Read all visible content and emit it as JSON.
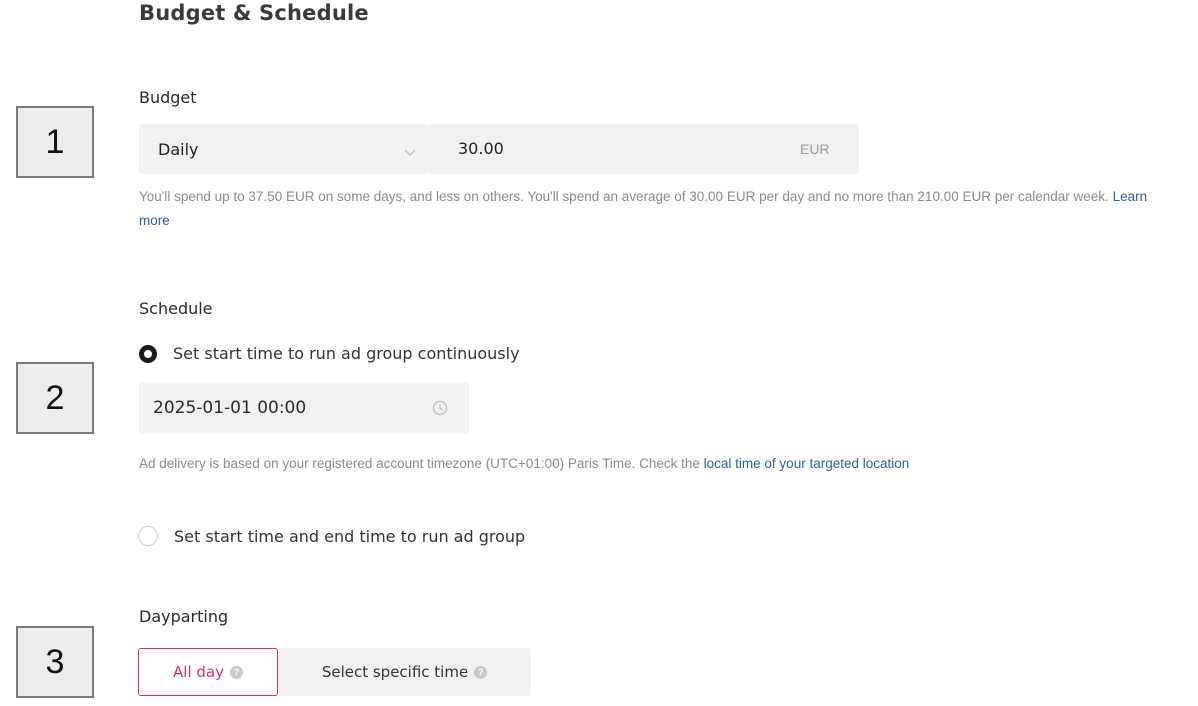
{
  "section": {
    "title": "Budget & Schedule"
  },
  "badges": [
    "1",
    "2",
    "3"
  ],
  "budget": {
    "label": "Budget",
    "mode": "Daily",
    "amount": "30.00",
    "currency": "EUR",
    "help_text": "You'll spend up to 37.50 EUR on some days, and less on others. You'll spend an average of 30.00 EUR per day and no more than 210.00 EUR per calendar week.",
    "learn_more": "Learn more"
  },
  "schedule": {
    "label": "Schedule",
    "option_continuous": "Set start time to run ad group continuously",
    "start_datetime": "2025-01-01 00:00",
    "help_prefix": "Ad delivery is based on your registered account timezone (UTC+01:00) Paris Time. Check the",
    "help_link": "local time of your targeted location",
    "option_start_end": "Set start time and end time to run ad group"
  },
  "dayparting": {
    "label": "Dayparting",
    "all_day": "All day",
    "specific_time": "Select specific time"
  },
  "colors": {
    "accent": "#e0306b",
    "link": "#2e5fa8",
    "field_bg": "#f1f1f1"
  }
}
